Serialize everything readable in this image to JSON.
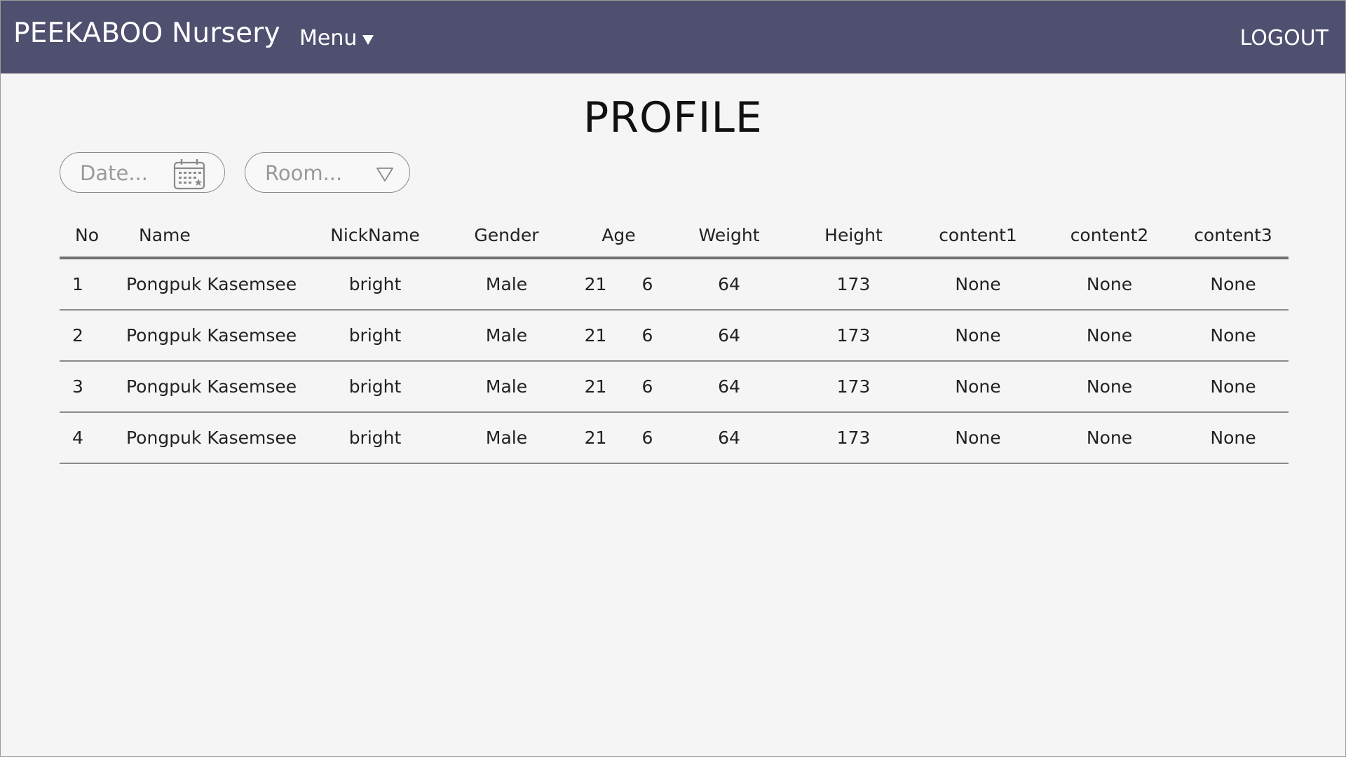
{
  "header": {
    "brand": "PEEKABOO Nursery",
    "menu_label": "Menu",
    "logout_label": "LOGOUT",
    "bg_color": "#4f4f70"
  },
  "page": {
    "title": "PROFILE"
  },
  "filters": {
    "date_placeholder": "Date...",
    "date_icon": "calendar-icon",
    "room_placeholder": "Room...",
    "room_icon": "triangle-down-icon"
  },
  "table": {
    "headers": [
      "No",
      "Name",
      "NickName",
      "Gender",
      "Age",
      "Weight",
      "Height",
      "content1",
      "content2",
      "content3"
    ],
    "rows": [
      {
        "no": "1",
        "name": "Pongpuk Kasemsee",
        "nickname": "bright",
        "gender": "Male",
        "age_a": "21",
        "age_b": "6",
        "weight": "64",
        "height": "173",
        "content1": "None",
        "content2": "None",
        "content3": "None"
      },
      {
        "no": "2",
        "name": "Pongpuk Kasemsee",
        "nickname": "bright",
        "gender": "Male",
        "age_a": "21",
        "age_b": "6",
        "weight": "64",
        "height": "173",
        "content1": "None",
        "content2": "None",
        "content3": "None"
      },
      {
        "no": "3",
        "name": "Pongpuk Kasemsee",
        "nickname": "bright",
        "gender": "Male",
        "age_a": "21",
        "age_b": "6",
        "weight": "64",
        "height": "173",
        "content1": "None",
        "content2": "None",
        "content3": "None"
      },
      {
        "no": "4",
        "name": "Pongpuk Kasemsee",
        "nickname": "bright",
        "gender": "Male",
        "age_a": "21",
        "age_b": "6",
        "weight": "64",
        "height": "173",
        "content1": "None",
        "content2": "None",
        "content3": "None"
      }
    ]
  }
}
